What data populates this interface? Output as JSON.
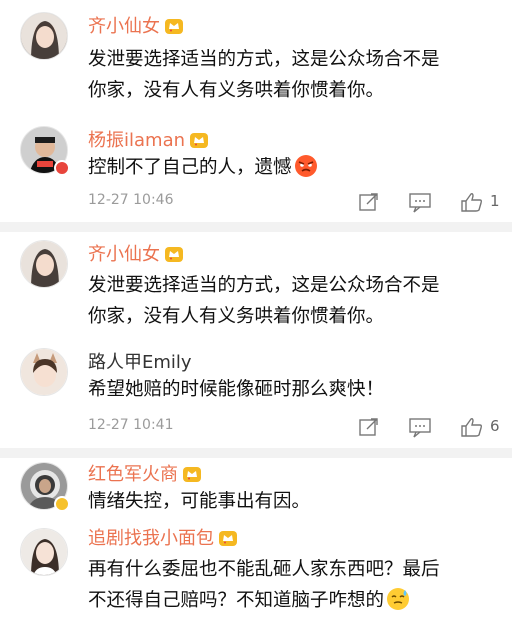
{
  "comments": [
    {
      "user": "齐小仙女",
      "lines": [
        "发泄要选择适当的方式，这是公众场合不是",
        "你家，没有人有义务哄着你惯着你。"
      ],
      "reply": {
        "user": "杨振ilaman",
        "text": "控制不了自己的人，遗憾",
        "emoji": "angry-face-icon",
        "time": "12-27 10:46",
        "likes": "1"
      }
    },
    {
      "user": "齐小仙女",
      "lines": [
        "发泄要选择适当的方式，这是公众场合不是",
        "你家，没有人有义务哄着你惯着你。"
      ],
      "reply": {
        "user": "路人甲Emily",
        "text": "希望她赔的时候能像砸时那么爽快！",
        "time": "12-27 10:41",
        "likes": "6"
      }
    },
    {
      "user": "红色军火商",
      "lines": [
        "情绪失控，可能事出有因。"
      ]
    },
    {
      "user": "追剧找我小面包",
      "lines": [
        "再有什么委屈也不能乱砸人家东西吧？最后",
        "不还得自己赔吗？不知道脑子咋想的"
      ],
      "emoji": "sweat-face-icon"
    }
  ],
  "colors": {
    "name": "#eb7350",
    "text": "#111111",
    "meta": "#9b9b9b",
    "divider": "#f2f2f2"
  }
}
